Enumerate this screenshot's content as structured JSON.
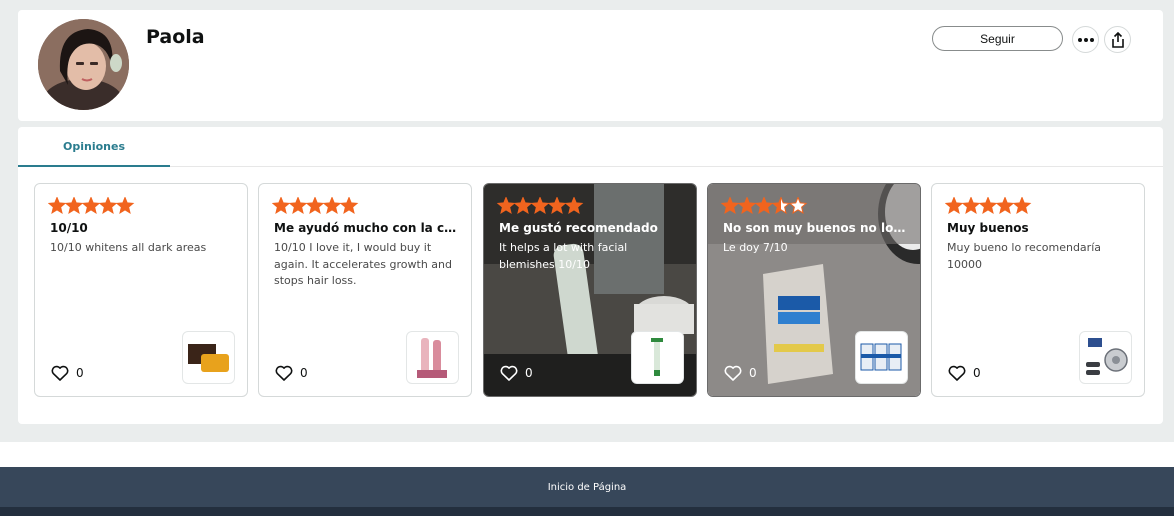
{
  "profile": {
    "name": "Paola",
    "follow_label": "Seguir",
    "more_icon": "ellipsis-icon",
    "share_icon": "share-icon"
  },
  "tabs": [
    {
      "label": "Opiniones",
      "active": true
    }
  ],
  "reviews": [
    {
      "rating": 5,
      "title": "10/10",
      "body": "10/10 whitens all dark areas",
      "likes": "0",
      "product": "soap-bars",
      "has_photo": false
    },
    {
      "rating": 5,
      "title": "Me ayudó mucho con la caída del cabello",
      "body": "10/10 I love it, I would buy it again. It accelerates growth and stops hair loss.",
      "likes": "0",
      "product": "hair-kit",
      "has_photo": false
    },
    {
      "rating": 5,
      "title": "Me gustó recomendado",
      "body": "It helps a lot with facial blemishes 10/10",
      "likes": "0",
      "product": "cream-tube",
      "has_photo": true
    },
    {
      "rating": 3.5,
      "title": "No son muy buenos no los recomiendo",
      "body": "Le doy 7/10",
      "likes": "0",
      "product": "anal-bleach-packets",
      "has_photo": true
    },
    {
      "rating": 5,
      "title": "Muy buenos",
      "body": "Muy bueno lo recomendaría 10000",
      "likes": "0",
      "product": "brake-kit",
      "has_photo": false
    }
  ],
  "footer": {
    "back_to_top": "Inicio de Página"
  },
  "colors": {
    "star": "#f1641e",
    "tab_accent": "#2a7c8e",
    "footer": "#37475a"
  }
}
